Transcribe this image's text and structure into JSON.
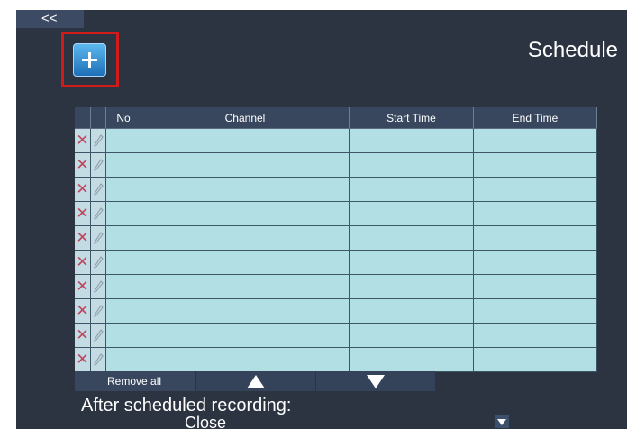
{
  "nav": {
    "back_label": "<<"
  },
  "header": {
    "title": "Schedule"
  },
  "table": {
    "columns": [
      "",
      "",
      "No",
      "Channel",
      "Start Time",
      "End Time"
    ],
    "rows": [
      {
        "no": "",
        "channel": "",
        "start": "",
        "end": ""
      },
      {
        "no": "",
        "channel": "",
        "start": "",
        "end": ""
      },
      {
        "no": "",
        "channel": "",
        "start": "",
        "end": ""
      },
      {
        "no": "",
        "channel": "",
        "start": "",
        "end": ""
      },
      {
        "no": "",
        "channel": "",
        "start": "",
        "end": ""
      },
      {
        "no": "",
        "channel": "",
        "start": "",
        "end": ""
      },
      {
        "no": "",
        "channel": "",
        "start": "",
        "end": ""
      },
      {
        "no": "",
        "channel": "",
        "start": "",
        "end": ""
      },
      {
        "no": "",
        "channel": "",
        "start": "",
        "end": ""
      },
      {
        "no": "",
        "channel": "",
        "start": "",
        "end": ""
      }
    ],
    "delete_glyph": "✕"
  },
  "controls": {
    "remove_all_label": "Remove all"
  },
  "after": {
    "label": "After scheduled recording:",
    "value": "Close"
  },
  "icons": [
    "back-icon",
    "add-icon",
    "delete-icon",
    "edit-pencil-icon",
    "move-up-icon",
    "move-down-icon",
    "dropdown-arrow-icon"
  ],
  "colors": {
    "panel_bg": "#2c3441",
    "header_bg": "#38475e",
    "cell_bg": "#b2dfe4",
    "delete_icon": "#c0455e",
    "highlight": "#d21a1a",
    "add_button": "#3a92d8"
  }
}
